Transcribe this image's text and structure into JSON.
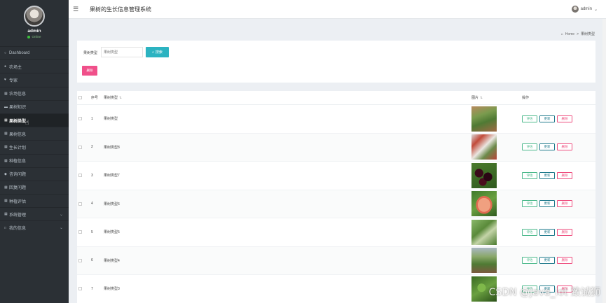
{
  "header": {
    "title": "果树的生长信息管理系统",
    "menu_icon": "hamburger-icon",
    "user": "admin"
  },
  "profile": {
    "name": "admin",
    "status": "Online"
  },
  "sidebar": {
    "items": [
      {
        "label": "Dashboard",
        "icon": "circle-icon"
      },
      {
        "label": "农场主",
        "icon": "user-icon"
      },
      {
        "label": "专家",
        "icon": "heart-icon"
      },
      {
        "label": "农场信息",
        "icon": "grid-icon"
      },
      {
        "label": "果树知识",
        "icon": "book-icon"
      },
      {
        "label": "果树类型",
        "icon": "grid-icon"
      },
      {
        "label": "果树信息",
        "icon": "grid-icon"
      },
      {
        "label": "生长计划",
        "icon": "grid-icon"
      },
      {
        "label": "种植信息",
        "icon": "grid-icon"
      },
      {
        "label": "咨询问题",
        "icon": "pin-icon"
      },
      {
        "label": "回复问题",
        "icon": "grid-icon"
      },
      {
        "label": "种植评估",
        "icon": "grid-icon"
      },
      {
        "label": "系统管理",
        "icon": "grid-icon"
      },
      {
        "label": "我的信息",
        "icon": "square-icon"
      }
    ],
    "active_index": 5
  },
  "breadcrumb": {
    "home": "Home",
    "separator": ">",
    "current": "果树类型"
  },
  "search": {
    "label": "果树类型",
    "placeholder": "果树类型",
    "button_label": "搜索",
    "delete_label": "删除"
  },
  "table": {
    "columns": [
      "序号",
      "果树类型",
      "图片",
      "操作"
    ],
    "rows": [
      {
        "index": "1",
        "type": "果树类型"
      },
      {
        "index": "2",
        "type": "果树类型8"
      },
      {
        "index": "3",
        "type": "果树类型7"
      },
      {
        "index": "4",
        "type": "果树类型6"
      },
      {
        "index": "5",
        "type": "果树类型5"
      },
      {
        "index": "6",
        "type": "果树类型4"
      },
      {
        "index": "7",
        "type": "果树类型3"
      }
    ],
    "actions": {
      "evaluate": "评估",
      "edit": "更新",
      "delete": "删除"
    }
  },
  "watermark": "CSDN @Java_lot 致诚狮",
  "colors": {
    "sidebar_bg": "#2b3035",
    "search_button": "#2cb3c1",
    "delete_button": "#f0508a",
    "evaluate": "#4ab88a",
    "edit": "#1f7a8c",
    "delete": "#ee4d7e"
  }
}
